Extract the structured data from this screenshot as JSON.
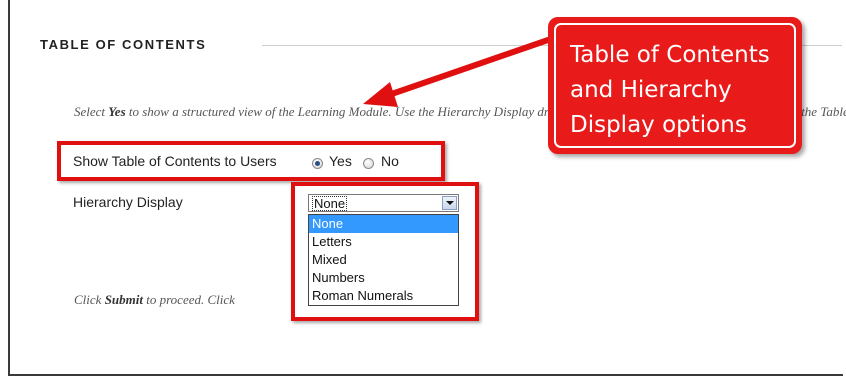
{
  "section": {
    "title": "TABLE OF CONTENTS"
  },
  "instructions": {
    "pre": "Select ",
    "bold": "Yes",
    "post": " to show a structured view of the Learning Module. Use the Hierarchy Display drop-down list to select the numbering scheme for the Table of Co"
  },
  "toc_option": {
    "label": "Show Table of Contents to Users",
    "yes_label": "Yes",
    "no_label": "No",
    "selected": "Yes"
  },
  "hierarchy": {
    "label": "Hierarchy Display",
    "selected_value": "None",
    "options": [
      "None",
      "Letters",
      "Mixed",
      "Numbers",
      "Roman Numerals"
    ],
    "highlighted_option": "None"
  },
  "submit_note": {
    "pre": "Click ",
    "bold": "Submit",
    "post": " to proceed. Click"
  },
  "callout": {
    "lines": [
      "Table of Contents",
      "and Hierarchy",
      "Display options"
    ]
  },
  "colors": {
    "highlight": "#e01010",
    "callout_bg": "#e81a1a",
    "option_selected": "#3399ff"
  }
}
